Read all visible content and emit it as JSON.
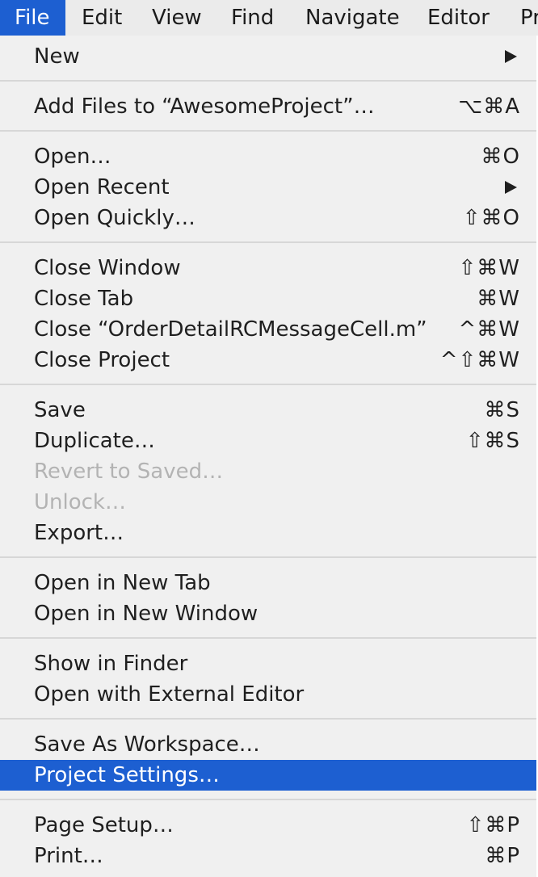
{
  "menubar": {
    "items": [
      "File",
      "Edit",
      "View",
      "Find",
      "Navigate",
      "Editor",
      "Pr"
    ]
  },
  "menu": {
    "new": {
      "label": "New"
    },
    "add_files": {
      "label": "Add Files to “AwesomeProject”…",
      "shortcut": "⌥⌘A"
    },
    "open": {
      "label": "Open…",
      "shortcut": "⌘O"
    },
    "open_recent": {
      "label": "Open Recent"
    },
    "open_quickly": {
      "label": "Open Quickly…",
      "shortcut": "⇧⌘O"
    },
    "close_window": {
      "label": "Close Window",
      "shortcut": "⇧⌘W"
    },
    "close_tab": {
      "label": "Close Tab",
      "shortcut": "⌘W"
    },
    "close_file": {
      "label": "Close “OrderDetailRCMessageCell.m”",
      "shortcut": "^⌘W"
    },
    "close_project": {
      "label": "Close Project",
      "shortcut": "^⇧⌘W"
    },
    "save": {
      "label": "Save",
      "shortcut": "⌘S"
    },
    "duplicate": {
      "label": "Duplicate…",
      "shortcut": "⇧⌘S"
    },
    "revert": {
      "label": "Revert to Saved…"
    },
    "unlock": {
      "label": "Unlock…"
    },
    "export": {
      "label": "Export…"
    },
    "open_new_tab": {
      "label": "Open in New Tab"
    },
    "open_new_window": {
      "label": "Open in New Window"
    },
    "show_in_finder": {
      "label": "Show in Finder"
    },
    "open_external": {
      "label": "Open with External Editor"
    },
    "save_workspace": {
      "label": "Save As Workspace…"
    },
    "project_settings": {
      "label": "Project Settings…"
    },
    "page_setup": {
      "label": "Page Setup…",
      "shortcut": "⇧⌘P"
    },
    "print": {
      "label": "Print…",
      "shortcut": "⌘P"
    }
  },
  "colors": {
    "highlight": "#1d5fd1",
    "menu_background": "#f0f0f0",
    "disabled_text": "#b3b3b3"
  }
}
